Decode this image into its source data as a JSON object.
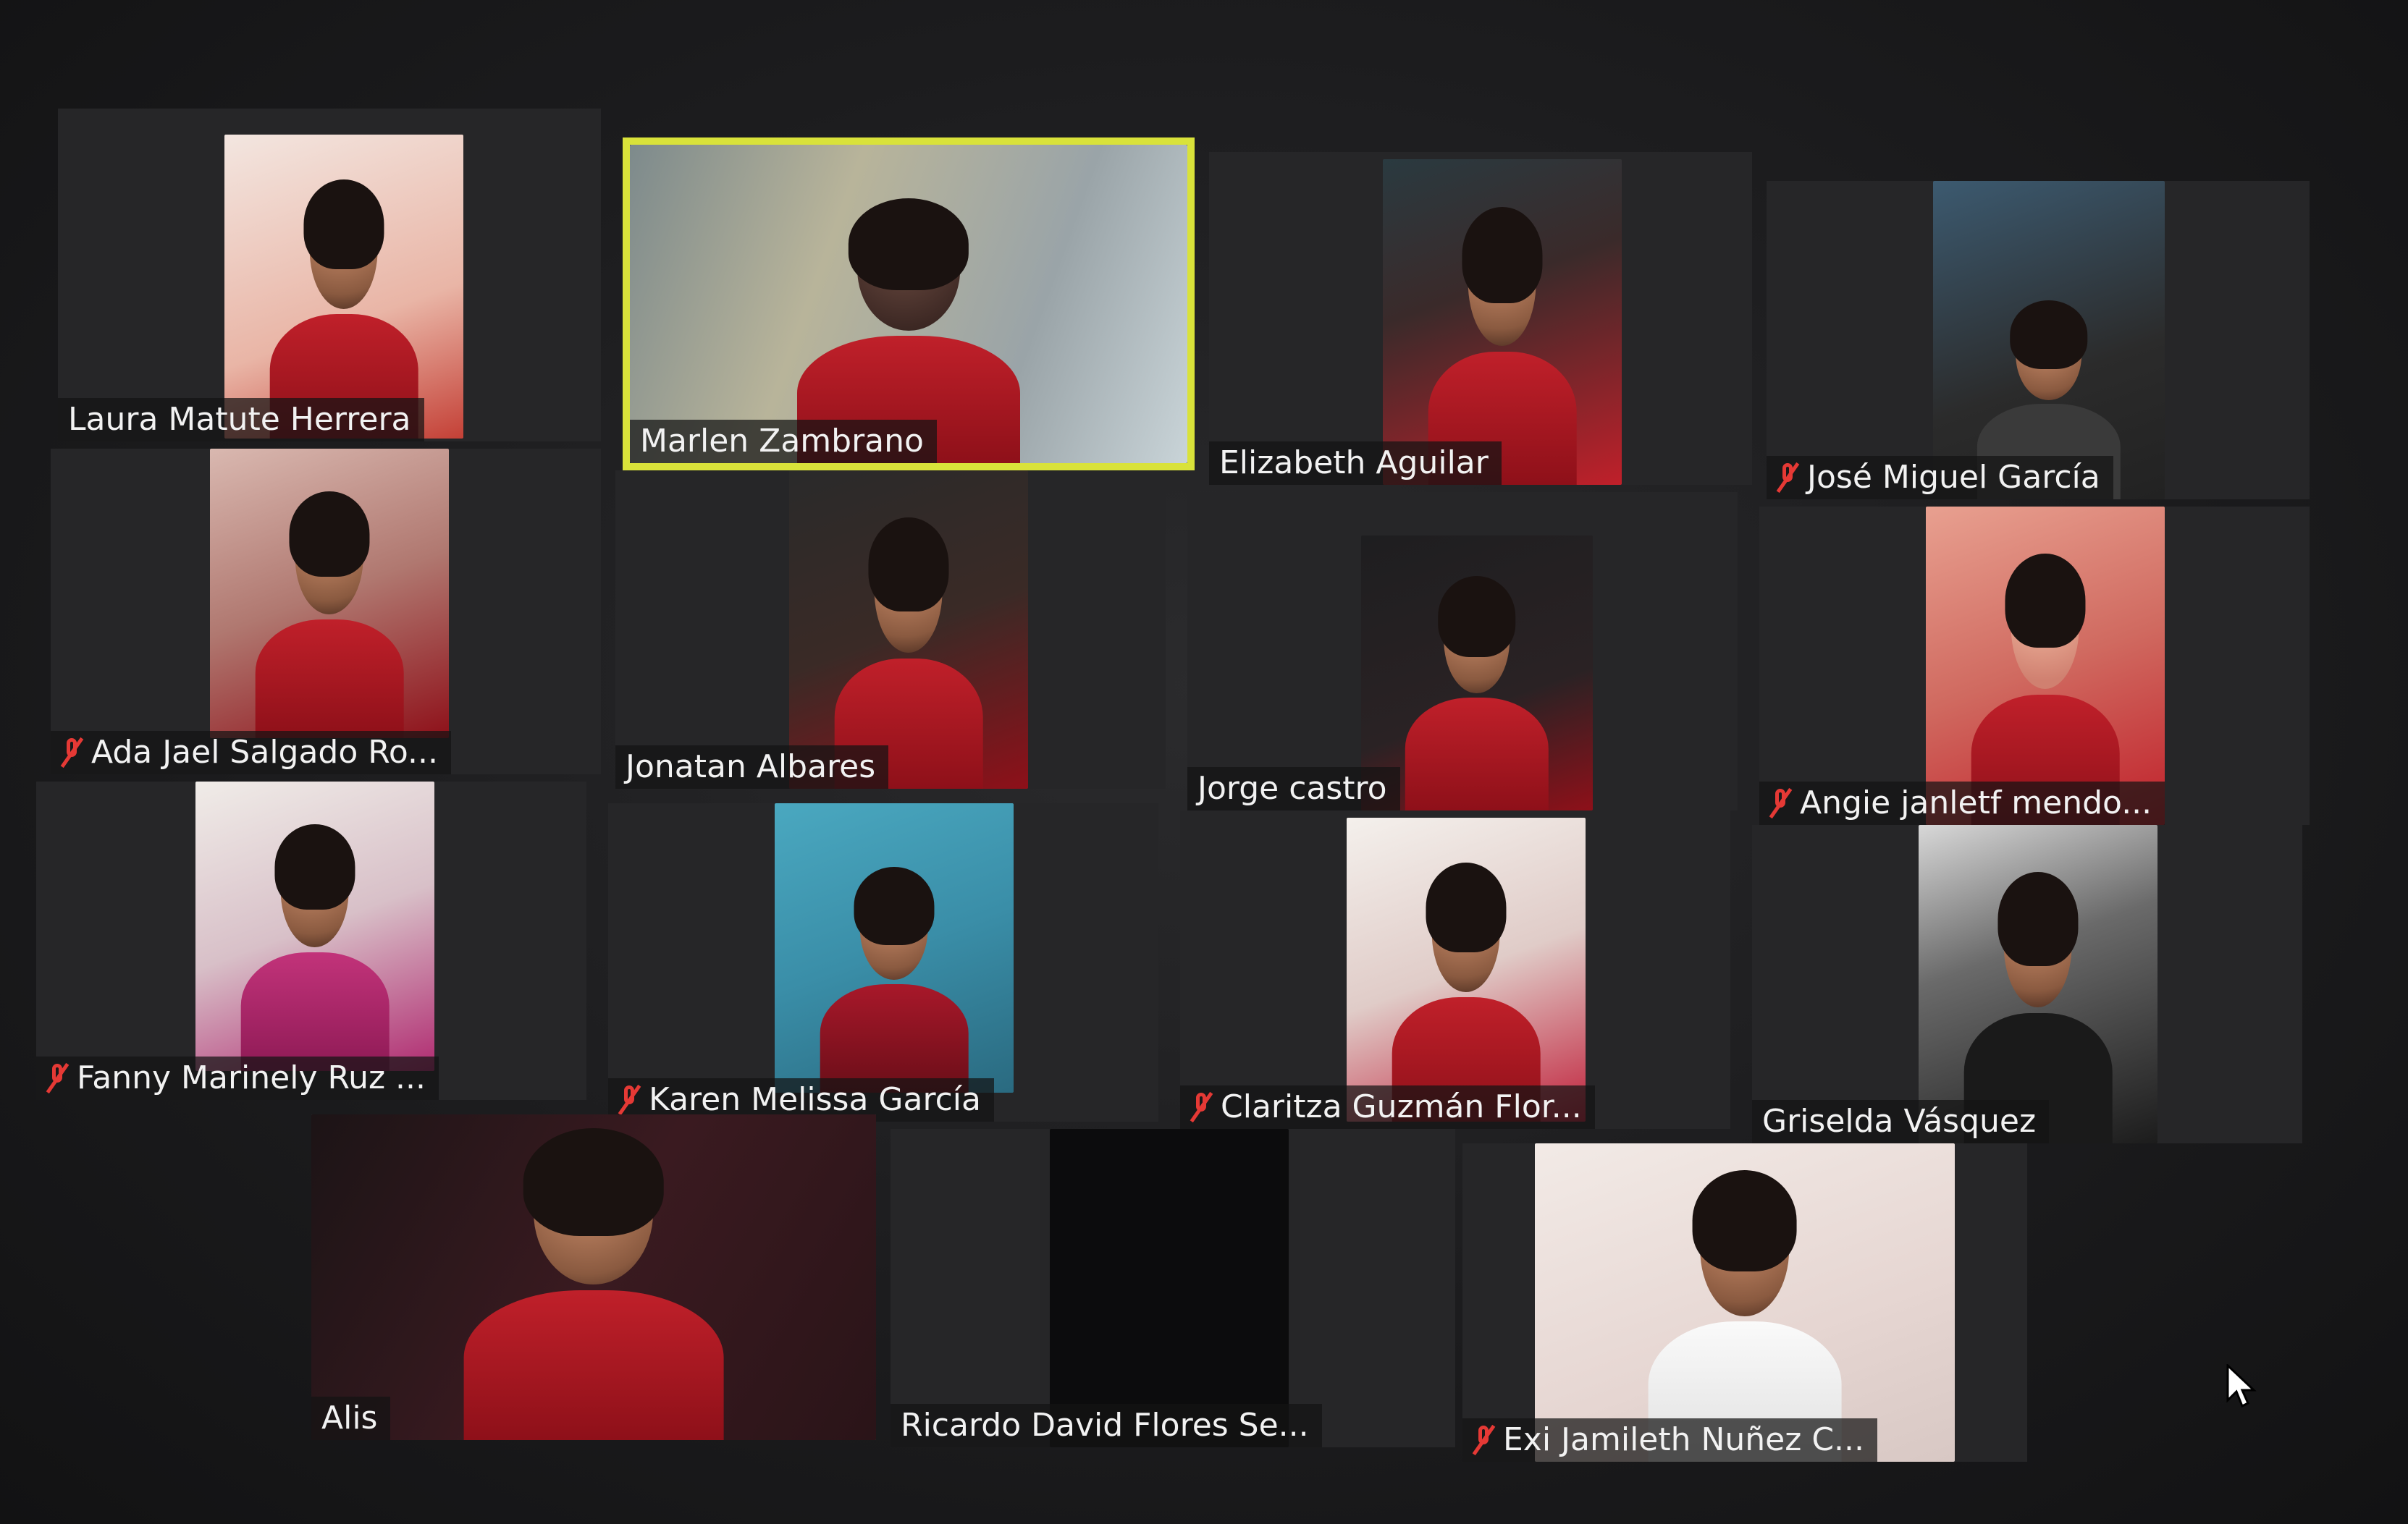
{
  "app": {
    "name": "Video meeting gallery view"
  },
  "colors": {
    "active_speaker_border": "#d9e23a",
    "muted_icon": "#e53935",
    "tile_bg": "#262628",
    "shirt_red": "#c0202a"
  },
  "participants": [
    {
      "name": "Laura Matute Herrera",
      "muted": false,
      "active": false
    },
    {
      "name": "Marlen Zambrano",
      "muted": false,
      "active": true
    },
    {
      "name": "Elizabeth Aguilar",
      "muted": false,
      "active": false
    },
    {
      "name": "José Miguel García",
      "muted": true,
      "active": false
    },
    {
      "name": "Ada Jael Salgado Ro...",
      "muted": true,
      "active": false
    },
    {
      "name": "Jonatan Albares",
      "muted": false,
      "active": false
    },
    {
      "name": "Jorge castro",
      "muted": false,
      "active": false
    },
    {
      "name": "Angie janletf mendo...",
      "muted": true,
      "active": false
    },
    {
      "name": "Fanny Marinely Ruz ...",
      "muted": true,
      "active": false
    },
    {
      "name": "Karen Melissa García",
      "muted": true,
      "active": false
    },
    {
      "name": "Claritza Guzmán Flor...",
      "muted": true,
      "active": false
    },
    {
      "name": "Griselda Vásquez",
      "muted": false,
      "active": false
    },
    {
      "name": "Alis",
      "muted": false,
      "active": false
    },
    {
      "name": "Ricardo David Flores Se...",
      "muted": false,
      "active": false,
      "video_off": true
    },
    {
      "name": "Exi Jamileth Nuñez C...",
      "muted": true,
      "active": false
    }
  ],
  "icons": {
    "muted": "mic-muted-icon",
    "cursor": "mouse-pointer-icon"
  }
}
